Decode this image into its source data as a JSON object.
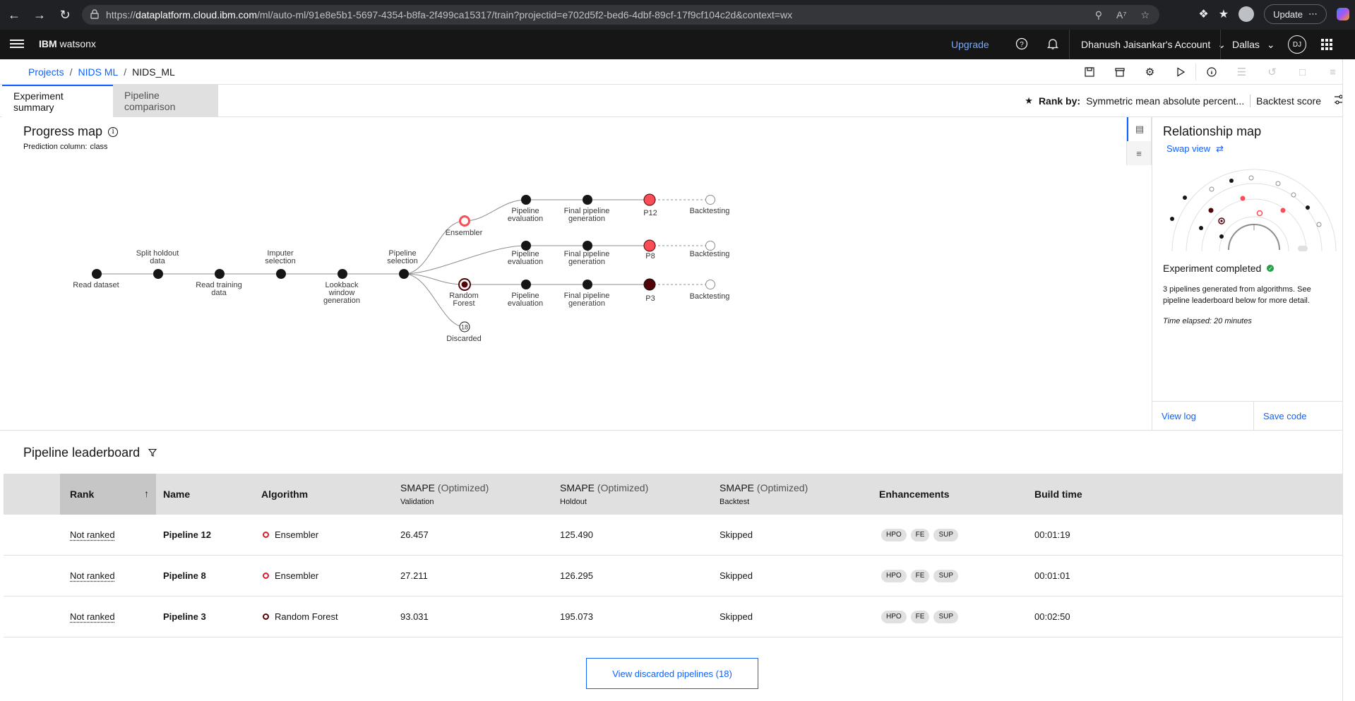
{
  "browser": {
    "url_prefix": "https://",
    "url_domain": "dataplatform.cloud.ibm.com",
    "url_path": "/ml/auto-ml/91e8e5b1-5697-4354-b8fa-2f499ca15317/train?projectid=e702d5f2-bed6-4dbf-89cf-17f9cf104c2d&context=wx",
    "update_label": "Update"
  },
  "header": {
    "brand_bold": "IBM",
    "brand_rest": " watsonx",
    "upgrade": "Upgrade",
    "account": "Dhanush Jaisankar's Account",
    "region": "Dallas",
    "avatar": "DJ"
  },
  "breadcrumb": {
    "items": [
      "Projects",
      "NIDS ML",
      "NIDS_ML"
    ]
  },
  "tabs": {
    "summary": "Experiment summary",
    "comparison": "Pipeline comparison"
  },
  "rank": {
    "label": "Rank by:",
    "metric": "Symmetric mean absolute percent...",
    "score": "Backtest score"
  },
  "progress_map": {
    "title": "Progress map",
    "prediction_label": "Prediction column:",
    "prediction_value": "class",
    "stages": {
      "read_dataset": "Read dataset",
      "split_holdout": [
        "Split holdout",
        "data"
      ],
      "read_training": [
        "Read training",
        "data"
      ],
      "imputer": [
        "Imputer",
        "selection"
      ],
      "lookback": [
        "Lookback",
        "window",
        "generation"
      ],
      "pipeline_selection": [
        "Pipeline",
        "selection"
      ],
      "ensembler": "Ensembler",
      "random_forest": [
        "Random",
        "Forest"
      ],
      "discarded": "Discarded",
      "discarded_count": "18",
      "pipeline_evaluation": [
        "Pipeline",
        "evaluation"
      ],
      "final_generation": [
        "Final pipeline",
        "generation"
      ],
      "backtesting": "Backtesting"
    },
    "pipelines": [
      "P12",
      "P8",
      "P3"
    ]
  },
  "relationship": {
    "title": "Relationship map",
    "swap": "Swap view",
    "status": "Experiment completed",
    "desc": "3 pipelines generated from algorithms. See pipeline leaderboard below for more detail.",
    "time": "Time elapsed: 20 minutes",
    "view_log": "View log",
    "save_code": "Save code"
  },
  "leaderboard": {
    "title": "Pipeline leaderboard",
    "columns": {
      "rank": "Rank",
      "name": "Name",
      "algorithm": "Algorithm",
      "smape": "SMAPE",
      "optimized": "(Optimized)",
      "validation": "Validation",
      "holdout": "Holdout",
      "backtest": "Backtest",
      "enhancements": "Enhancements",
      "build_time": "Build time"
    },
    "rows": [
      {
        "rank": "Not ranked",
        "name": "Pipeline 12",
        "algorithm": "Ensembler",
        "validation": "26.457",
        "holdout": "125.490",
        "backtest": "Skipped",
        "tags": [
          "HPO",
          "FE",
          "SUP"
        ],
        "build": "00:01:19"
      },
      {
        "rank": "Not ranked",
        "name": "Pipeline 8",
        "algorithm": "Ensembler",
        "validation": "27.211",
        "holdout": "126.295",
        "backtest": "Skipped",
        "tags": [
          "HPO",
          "FE",
          "SUP"
        ],
        "build": "00:01:01"
      },
      {
        "rank": "Not ranked",
        "name": "Pipeline 3",
        "algorithm": "Random Forest",
        "validation": "93.031",
        "holdout": "195.073",
        "backtest": "Skipped",
        "tags": [
          "HPO",
          "FE",
          "SUP"
        ],
        "build": "00:02:50"
      }
    ],
    "discarded_button": "View discarded pipelines (18)"
  },
  "colors": {
    "accent": "#0f62fe",
    "ensembler": "#da1e28",
    "random_forest": "#520408",
    "success": "#24a148"
  }
}
